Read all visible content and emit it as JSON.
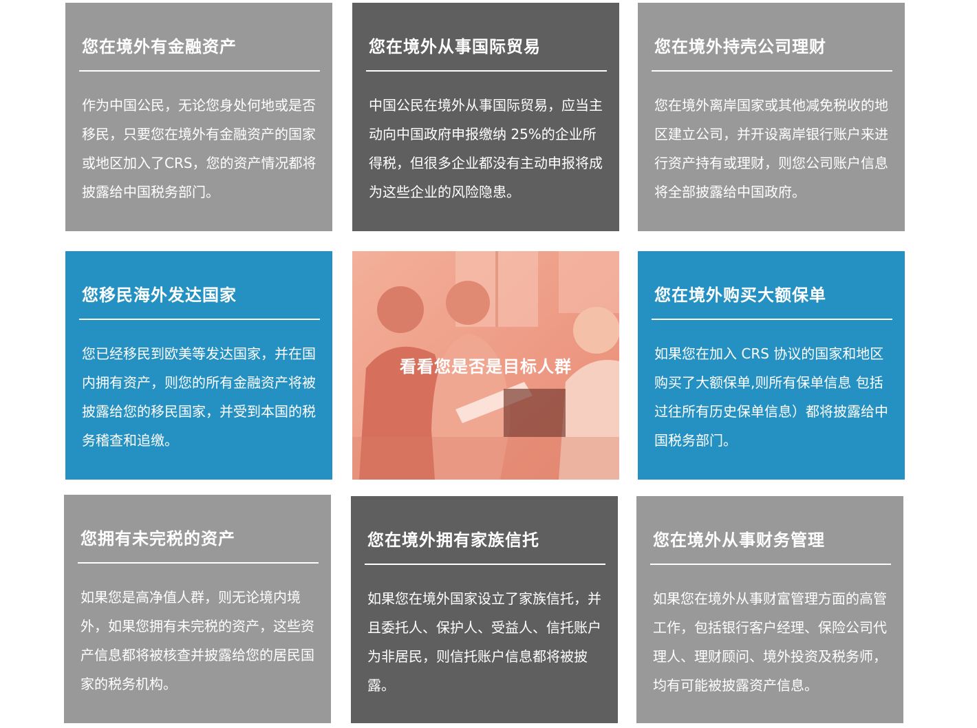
{
  "cards": [
    {
      "title": "您在境外有金融资产",
      "body": "作为中国公民，无论您身处何地或是否移民，只要您在境外有金融资产的国家或地区加入了CRS，您的资产情况都将披露给中国税务部门。"
    },
    {
      "title": "您在境外从事国际贸易",
      "body": "中国公民在境外从事国际贸易，应当主动向中国政府申报缴纳 25%的企业所得税，但很多企业都没有主动申报将成为这些企业的风险隐患。"
    },
    {
      "title": "您在境外持壳公司理财",
      "body": "您在境外离岸国家或其他减免税收的地区建立公司，并开设离岸银行账户来进行资产持有或理财，则您公司账户信息将全部披露给中国政府。"
    },
    {
      "title": "您移民海外发达国家",
      "body": "您已经移民到欧美等发达国家，并在国内拥有资产，则您的所有金融资产将被披露给您的移民国家，并受到本国的税务稽查和追缴。"
    },
    {
      "title": "您在境外购买大额保单",
      "body": "如果您在加入 CRS 协议的国家和地区购买了大额保单,则所有保单信息 包括过往所有历史保单信息）都将披露给中国税务部门。"
    },
    {
      "title": "您拥有未完税的资产",
      "body": "如果您是高净值人群，则无论境内境外，如果您拥有未完税的资产，这些资产信息都将被核查并披露给您的居民国家的税务机构。"
    },
    {
      "title": "您在境外拥有家族信托",
      "body": "如果您在境外国家设立了家族信托，并且委托人、保护人、受益人、信托账户为非居民，则信托账户信息都将被披露。"
    },
    {
      "title": "您在境外从事财务管理",
      "body": "如果您在境外从事财富管理方面的高管工作，包括银行客户经理、保险公司代理人、理财顾问、境外投资及税务师，均有可能被披露资产信息。"
    }
  ],
  "photo": {
    "caption": "看看您是否是目标人群"
  },
  "colors": {
    "gray": "#999999",
    "dark": "#5f5f5f",
    "blue": "#2591c2",
    "photo_tint": "#ee9b84"
  }
}
